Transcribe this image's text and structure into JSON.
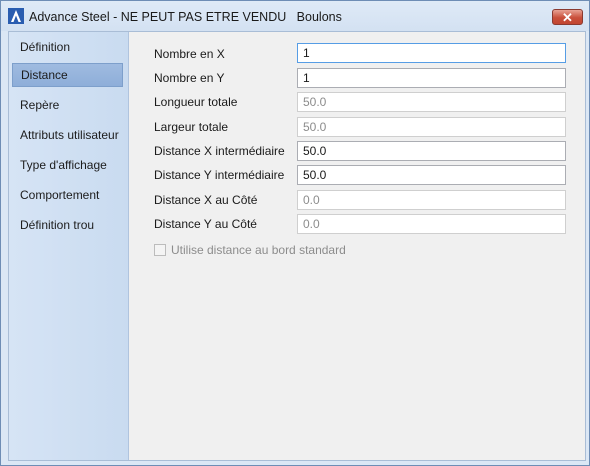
{
  "window": {
    "title": "Advance Steel - NE PEUT PAS ETRE VENDU   Boulons",
    "close_glyph": "✕",
    "icon": "advance-steel-logo"
  },
  "sidebar": {
    "items": [
      {
        "label": "Définition"
      },
      {
        "label": "Distance"
      },
      {
        "label": "Repère"
      },
      {
        "label": "Attributs utilisateur"
      },
      {
        "label": "Type d'affichage"
      },
      {
        "label": "Comportement"
      },
      {
        "label": "Définition trou"
      }
    ],
    "active_label": "Distance"
  },
  "form": {
    "fields": [
      {
        "label": "Nombre en X",
        "value": "1",
        "enabled": true
      },
      {
        "label": "Nombre en Y",
        "value": "1",
        "enabled": true
      },
      {
        "label": "Longueur totale",
        "value": "50.0",
        "enabled": false
      },
      {
        "label": "Largeur totale",
        "value": "50.0",
        "enabled": false
      },
      {
        "label": "Distance X intermédiaire",
        "value": "50.0",
        "enabled": true
      },
      {
        "label": "Distance Y intermédiaire",
        "value": "50.0",
        "enabled": true
      },
      {
        "label": "Distance X au Côté",
        "value": "0.0",
        "enabled": false
      },
      {
        "label": "Distance Y au Côté",
        "value": "0.0",
        "enabled": false
      }
    ],
    "checkbox": {
      "label": "Utilise distance au bord standard",
      "checked": false,
      "enabled": false
    }
  },
  "colors": {
    "accent": "#8eaed9",
    "title_bar": "#d3e1f2",
    "close": "#c9503b"
  }
}
